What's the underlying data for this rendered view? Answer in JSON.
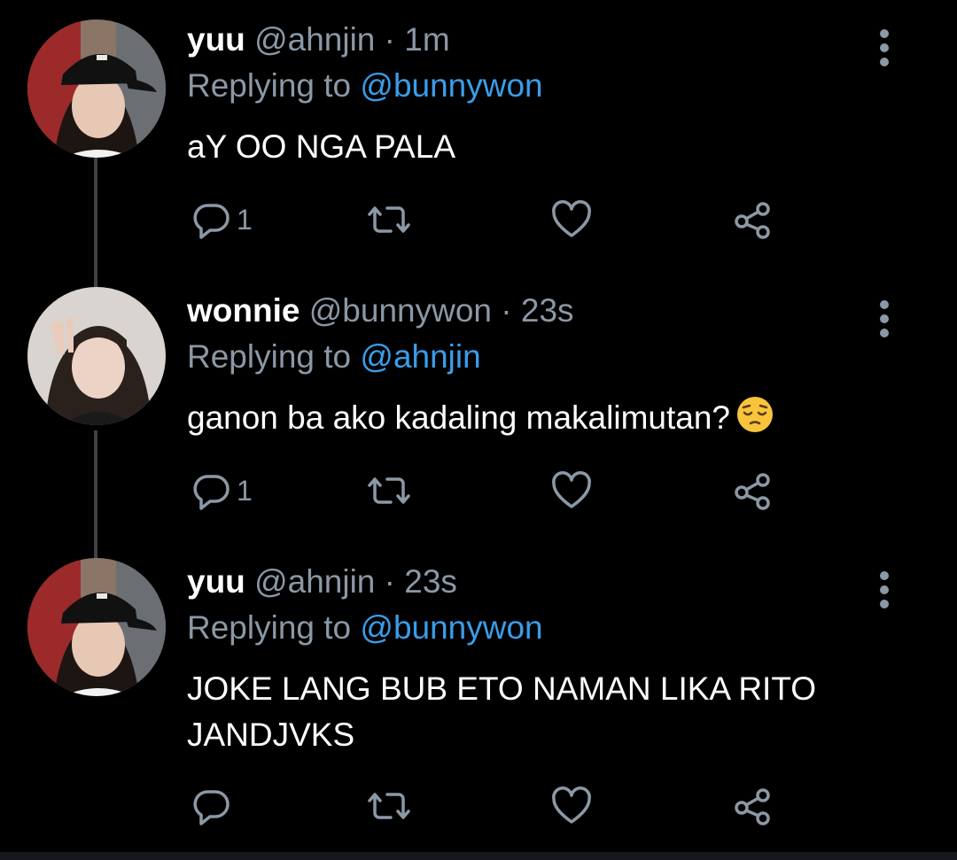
{
  "tweets": [
    {
      "display_name": "yuu",
      "handle": "@ahnjin",
      "separator": "·",
      "time": "1m",
      "replying_prefix": "Replying to",
      "replying_to": "@bunnywon",
      "text": "aY OO NGA PALA",
      "reply_count": "1",
      "avatar": "avatar-black-cap"
    },
    {
      "display_name": "wonnie",
      "handle": "@bunnywon",
      "separator": "·",
      "time": "23s",
      "replying_prefix": "Replying to",
      "replying_to": "@ahnjin",
      "text": "ganon ba ako kadaling makalimutan?",
      "emoji": "pensive-face",
      "reply_count": "1",
      "avatar": "avatar-peace-sign"
    },
    {
      "display_name": "yuu",
      "handle": "@ahnjin",
      "separator": "·",
      "time": "23s",
      "replying_prefix": "Replying to",
      "replying_to": "@bunnywon",
      "text_line1": "JOKE LANG BUB ETO NAMAN LIKA RITO",
      "text_line2": "JANDJVKS",
      "reply_count": "",
      "avatar": "avatar-black-cap"
    }
  ],
  "colors": {
    "background": "#000000",
    "secondary_text": "#8b98a5",
    "mention": "#3a9de8",
    "thread_line": "#3d4247",
    "icon": "#8b98a5"
  },
  "icons": [
    "reply-icon",
    "retweet-icon",
    "like-icon",
    "share-icon",
    "more-options-icon"
  ]
}
